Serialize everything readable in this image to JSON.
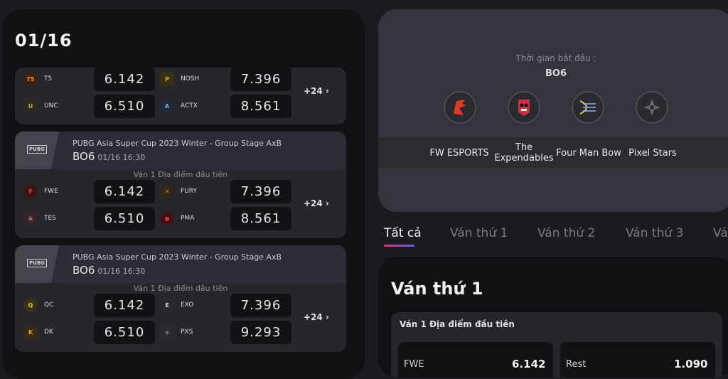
{
  "date": "01/16",
  "cards": [
    {
      "tournament": "",
      "bo": "",
      "time": "",
      "round_label": "",
      "teams": [
        {
          "name": "T5",
          "score": "6.142",
          "icon": "t5-logo",
          "color": "#f08a2a"
        },
        {
          "name": "UNC",
          "score": "6.510",
          "icon": "unc-logo",
          "color": "#c9a96a"
        },
        {
          "name": "NOSH",
          "score": "7.396",
          "icon": "nosh-logo",
          "color": "#e8b23a"
        },
        {
          "name": "ACTX",
          "score": "8.561",
          "icon": "actx-logo",
          "color": "#7fb3e8"
        }
      ],
      "more": "+24 ›"
    },
    {
      "logo": "PUBG",
      "tournament": "PUBG Asia Super Cup 2023 Winter - Group Stage AxB",
      "bo": "BO6",
      "time": "01/16 16:30",
      "round_label": "Ván 1 Địa điểm đầu tiên",
      "teams": [
        {
          "name": "FWE",
          "score": "6.142",
          "icon": "fwe-logo",
          "color": "#e23a2a"
        },
        {
          "name": "TES",
          "score": "6.510",
          "icon": "tes-logo",
          "color": "#d9d9dd"
        },
        {
          "name": "FURY",
          "score": "7.396",
          "icon": "fury-logo",
          "color": "#d08a4a"
        },
        {
          "name": "PMA",
          "score": "8.561",
          "icon": "pma-logo",
          "color": "#e0303a"
        }
      ],
      "more": "+24 ›"
    },
    {
      "logo": "PUBG",
      "tournament": "PUBG Asia Super Cup 2023 Winter - Group Stage AxB",
      "bo": "BO6",
      "time": "01/16 16:30",
      "round_label": "Ván 1 Địa điểm đầu tiên",
      "teams": [
        {
          "name": "QC",
          "score": "6.142",
          "icon": "qc-logo",
          "color": "#e8c24a"
        },
        {
          "name": "DK",
          "score": "6.510",
          "icon": "dk-logo",
          "color": "#f0a02a"
        },
        {
          "name": "EXO",
          "score": "7.396",
          "icon": "exo-logo",
          "color": "#e0e0e4"
        },
        {
          "name": "PXS",
          "score": "9.293",
          "icon": "pxs-logo",
          "color": "#8a8a92"
        }
      ],
      "more": "+24 ›"
    }
  ],
  "match_info": {
    "start_label": "Thời gian bắt đầu :",
    "bo": "BO6",
    "teams": [
      {
        "name": "FW ESPORTS",
        "icon": "fw-esports-logo",
        "color": "#e23a2a"
      },
      {
        "name": "The Expendables",
        "icon": "expendables-logo",
        "color": "#c93040"
      },
      {
        "name": "Four Man Bow",
        "icon": "four-man-bow-logo",
        "color": "#e8c24a"
      },
      {
        "name": "Pixel Stars",
        "icon": "pixel-stars-logo",
        "color": "#8a8a92"
      }
    ]
  },
  "tabs": [
    "Tất cả",
    "Ván thứ 1",
    "Ván thứ 2",
    "Ván thứ 3",
    "Vá"
  ],
  "active_tab": 0,
  "round_section": {
    "title": "Ván thứ 1",
    "card_title": "Ván 1 Địa điểm đầu tiên",
    "entries": [
      {
        "name": "FWE",
        "value": "6.142"
      },
      {
        "name": "Rest",
        "value": "1.090"
      }
    ]
  },
  "colors": {
    "accent_start": "#e2336b",
    "accent_end": "#5f5cf0"
  }
}
